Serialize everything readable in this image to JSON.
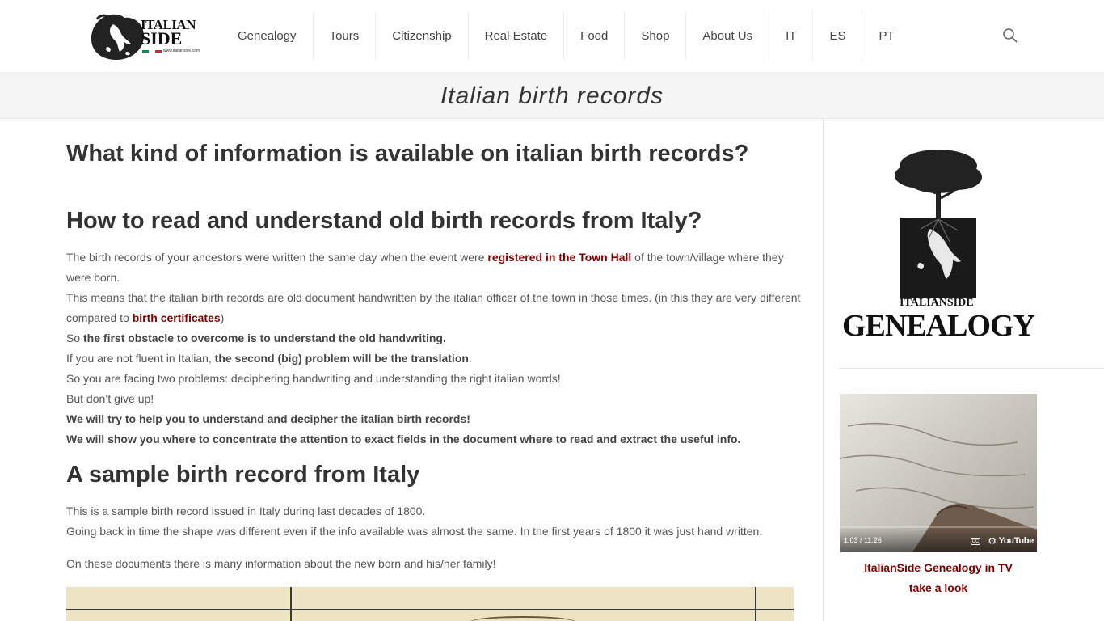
{
  "header": {
    "logo_text_top": "ITALIAN",
    "logo_text_bottom": "SIDE",
    "logo_small_text": "www.italianside.com",
    "nav": [
      "Genealogy",
      "Tours",
      "Citizenship",
      "Real Estate",
      "Food",
      "Shop",
      "About Us",
      "IT",
      "ES",
      "PT"
    ],
    "search_icon": "search-icon"
  },
  "page_title": "Italian birth records",
  "main": {
    "heading_1": "What kind of information is available on italian birth records?",
    "heading_2": "How to read and understand old birth records from Italy?",
    "p1_l1_a": "The birth records of your ancestors were written the same day when the event were ",
    "p1_l1_link": "registered in the Town Hall",
    "p1_l1_b": " of the town/village where they were born.",
    "p1_l2_a": "This means that the italian birth records are old document handwritten by the italian officer of the town in those times. (in this they are very different compared to ",
    "p1_l2_link": "birth certificates",
    "p1_l2_b": ")",
    "p1_l3_a": "So ",
    "p1_l3_bold": "the first obstacle to overcome is to understand the old handwriting.",
    "p1_l4_a": "If you are not fluent in Italian, ",
    "p1_l4_bold": "the second (big) problem will be the translation",
    "p1_l4_b": ".",
    "p1_l5": "So you are facing two problems: deciphering handwriting and understanding the right italian words!",
    "p1_l6": "But don’t give up!",
    "p1_l7": "We will try to help you to understand and decipher the italian birth records!",
    "p1_l8": "We will show you where to concentrate the attention to exact fields in the document where to read and extract the useful info.",
    "heading_3": "A sample birth record from Italy",
    "p2_l1": "This is a sample birth record issued in Italy during last decades of 1800.",
    "p2_l2": "Going back in time the shape was different even if the info available was almost the same. In the first years of 1800 it was just hand written.",
    "p3": "On these documents there is many information about the new born and his/her family!"
  },
  "sidebar": {
    "logo_sub": "ITALIANSIDE",
    "logo_title": "GENEALOGY",
    "video_time": "1:03 / 11:26",
    "video_platform": "YouTube",
    "video_cc": "CC",
    "caption_l1": "ItalianSide Genealogy in TV",
    "caption_l2": "take a look"
  },
  "colors": {
    "link": "#800000",
    "italy_green": "#009246",
    "italy_red": "#ce2b37"
  }
}
